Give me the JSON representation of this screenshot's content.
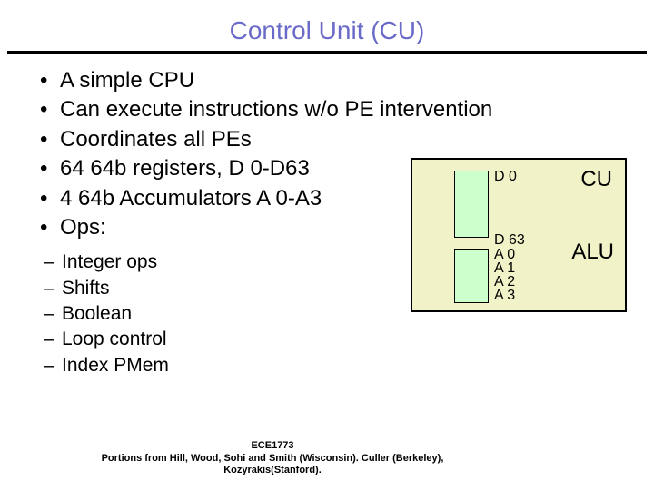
{
  "title": "Control Unit (CU)",
  "bullets": [
    "A simple CPU",
    "Can execute instructions w/o PE intervention",
    "Coordinates all PEs",
    "64 64b registers, D 0-D63",
    "4 64b Accumulators A 0-A3",
    "Ops:"
  ],
  "sub_bullets": [
    "Integer ops",
    "Shifts",
    "Boolean",
    "Loop control",
    "Index PMem"
  ],
  "diagram": {
    "d_top": "D 0",
    "d_bottom": "D 63",
    "a0": "A 0",
    "a1": "A 1",
    "a2": "A 2",
    "a3": "A 3",
    "cu": "CU",
    "alu": "ALU"
  },
  "footer": {
    "line1": "ECE1773",
    "line2": "Portions from Hill, Wood, Sohi and Smith (Wisconsin). Culler (Berkeley), Kozyrakis(Stanford)."
  }
}
